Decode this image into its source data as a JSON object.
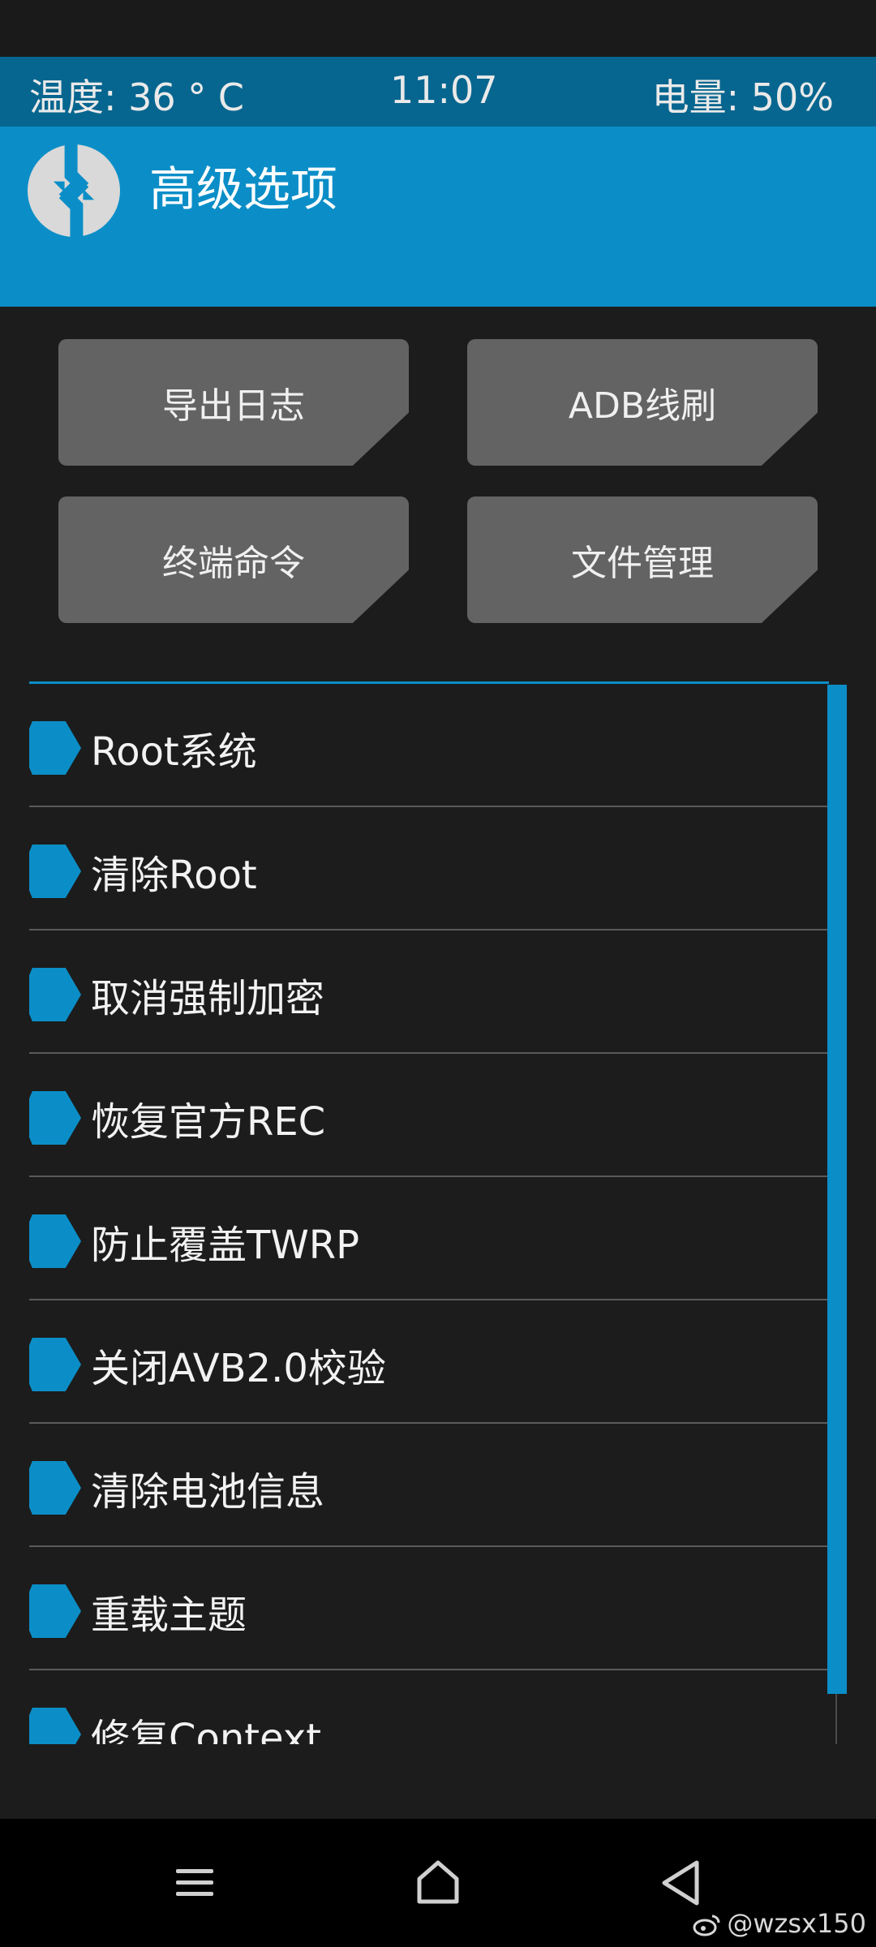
{
  "status_bar": {
    "temperature": "温度: 36 ° C",
    "time": "11:07",
    "battery": "电量: 50%"
  },
  "header": {
    "title": "高级选项",
    "logo_icon": "twrp-logo-icon"
  },
  "buttons": [
    {
      "label": "导出日志"
    },
    {
      "label": "ADB线刷"
    },
    {
      "label": "终端命令"
    },
    {
      "label": "文件管理"
    }
  ],
  "list": {
    "items": [
      {
        "label": "Root系统"
      },
      {
        "label": "清除Root"
      },
      {
        "label": "取消强制加密"
      },
      {
        "label": "恢复官方REC"
      },
      {
        "label": "防止覆盖TWRP"
      },
      {
        "label": "关闭AVB2.0校验"
      },
      {
        "label": "清除电池信息"
      },
      {
        "label": "重载主题"
      },
      {
        "label": "修复Context"
      }
    ]
  },
  "nav": {
    "menu_icon": "menu-icon",
    "home_icon": "home-icon",
    "back_icon": "back-icon"
  },
  "watermark": {
    "text": "@wzsx150",
    "icon": "weibo-icon"
  },
  "colors": {
    "accent": "#0b8ec7",
    "status_bar": "#07668f",
    "background": "#1c1c1c",
    "button": "#636363"
  }
}
